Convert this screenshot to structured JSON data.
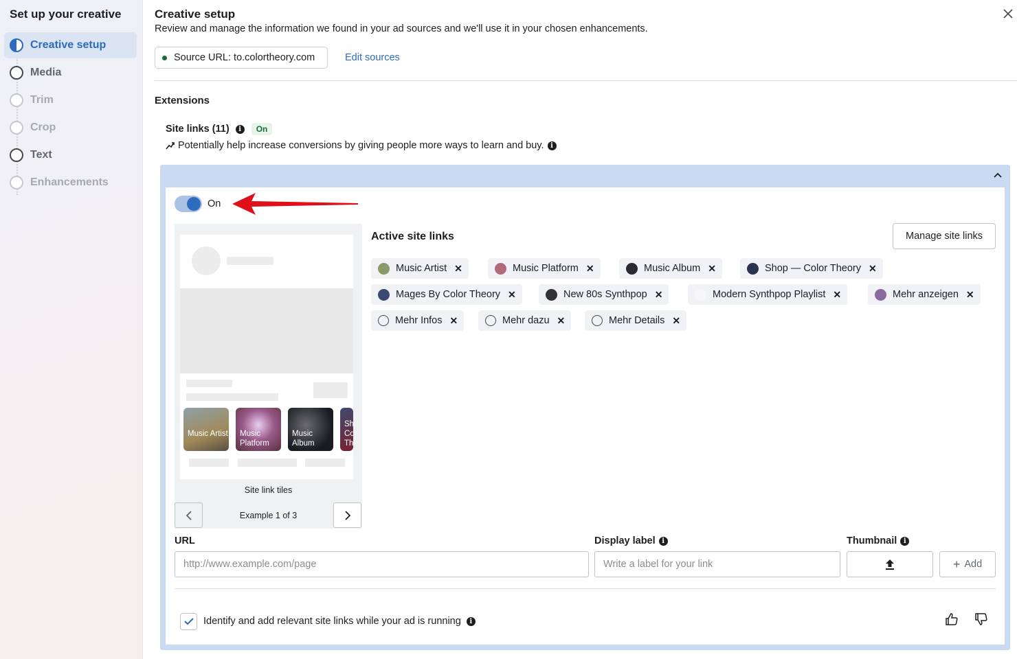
{
  "sidebar": {
    "title": "Set up your creative",
    "steps": [
      {
        "label": "Creative setup",
        "state": "active"
      },
      {
        "label": "Media",
        "state": "done"
      },
      {
        "label": "Trim",
        "state": "disabled"
      },
      {
        "label": "Crop",
        "state": "disabled"
      },
      {
        "label": "Text",
        "state": "done"
      },
      {
        "label": "Enhancements",
        "state": "disabled"
      }
    ]
  },
  "header": {
    "title": "Creative setup",
    "subtitle": "Review and manage the information we found in your ad sources and we'll use it in your chosen enhancements."
  },
  "source": {
    "label": "Source URL: to.colortheory.com",
    "edit": "Edit sources"
  },
  "extensions": {
    "heading": "Extensions",
    "site_links": {
      "title": "Site links (11)",
      "status": "On",
      "description": "Potentially help increase conversions by giving people more ways to learn and buy.",
      "toggle_label": "On",
      "toggle_on": true
    }
  },
  "preview": {
    "tiles": [
      {
        "label": "Music Artist"
      },
      {
        "label": "Music Platform"
      },
      {
        "label": "Music Album"
      },
      {
        "label": "Sh Co Th"
      }
    ],
    "caption": "Site link tiles",
    "example": "Example 1 of 3"
  },
  "active_links": {
    "heading": "Active site links",
    "manage": "Manage site links",
    "chips": [
      {
        "label": "Music Artist",
        "color": "#8a9a6a"
      },
      {
        "label": "Music Platform",
        "color": "#b06a7a"
      },
      {
        "label": "Music Album",
        "color": "#2a2a30"
      },
      {
        "label": "Shop — Color Theory",
        "color": "#2a3450"
      },
      {
        "label": "Mages By Color Theory",
        "color": "#3a4a70"
      },
      {
        "label": "New 80s Synthpop",
        "color": "#333333"
      },
      {
        "label": "Modern Synthpop Playlist",
        "color": "#f7f7f7"
      },
      {
        "label": "Mehr anzeigen",
        "color": "#8a6a9a"
      },
      {
        "label": "Mehr Infos",
        "color": ""
      },
      {
        "label": "Mehr dazu",
        "color": ""
      },
      {
        "label": "Mehr Details",
        "color": ""
      }
    ]
  },
  "form": {
    "url_label": "URL",
    "url_placeholder": "http://www.example.com/page",
    "display_label": "Display label",
    "display_placeholder": "Write a label for your link",
    "thumbnail_label": "Thumbnail",
    "add": "Add"
  },
  "auto_add": {
    "label": "Identify and add relevant site links while your ad is running",
    "checked": true
  },
  "colors": {
    "accent": "#2d6bbd",
    "panel": "#c9daf2",
    "arrow": "#e0101a"
  }
}
